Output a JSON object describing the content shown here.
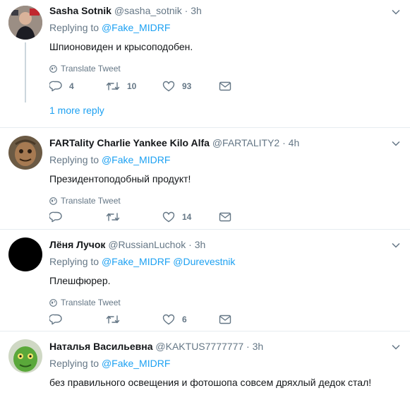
{
  "tweets": [
    {
      "name": "Sasha Sotnik",
      "handle": "@sasha_sotnik",
      "time": "· 3h",
      "replying_label": "Replying to",
      "mentions": [
        "@Fake_MIDRF"
      ],
      "text": "Шпионовиден и крысоподобен.",
      "translate": "Translate Tweet",
      "replies": "4",
      "retweets": "10",
      "likes": "93",
      "more_reply": "1 more reply"
    },
    {
      "name": "FARTality Charlie Yankee Kilo Alfa",
      "handle": "@FARTALITY2",
      "time": "· 4h",
      "replying_label": "Replying to",
      "mentions": [
        "@Fake_MIDRF"
      ],
      "text": "Президентоподобный продукт!",
      "translate": "Translate Tweet",
      "replies": "",
      "retweets": "",
      "likes": "14"
    },
    {
      "name": "Лёня Лучок",
      "handle": "@RussianLuchok",
      "time": "· 3h",
      "replying_label": "Replying to",
      "mentions": [
        "@Fake_MIDRF",
        "@Durevestnik"
      ],
      "text": "Плешфюрер.",
      "translate": "Translate Tweet",
      "replies": "",
      "retweets": "",
      "likes": "6"
    },
    {
      "name": "Наталья Васильевна",
      "handle": "@KAKTUS7777777",
      "time": "· 3h",
      "replying_label": "Replying to",
      "mentions": [
        "@Fake_MIDRF"
      ],
      "text": "без правильного освещения и фотошопа совсем дряхлый дедок стал!"
    }
  ],
  "colors": {
    "link": "#1da1f2",
    "secondary": "#657786",
    "divider": "#e6ecf0"
  },
  "icons": [
    "translate-globe-icon",
    "reply-icon",
    "retweet-icon",
    "like-heart-icon",
    "direct-message-icon",
    "chevron-down-icon"
  ]
}
